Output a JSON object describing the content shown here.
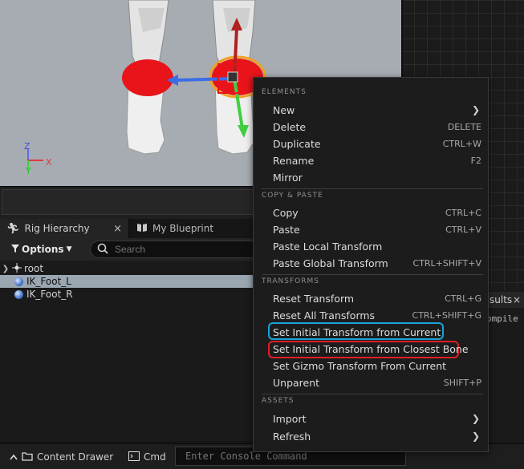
{
  "viewport": {
    "axis": {
      "z": "Z",
      "y": "Y",
      "x": "X"
    },
    "colors": {
      "background": "#a7acb3",
      "axis_x": "#e03a3a",
      "axis_y": "#3fcf3f",
      "axis_z": "#5a6ee6"
    }
  },
  "tabs": [
    {
      "label": "Rig Hierarchy",
      "icon": "running-figure-icon",
      "close": "×"
    },
    {
      "label": "My Blueprint",
      "icon": "book-icon"
    }
  ],
  "hierarchy": {
    "options_label": "Options",
    "search_placeholder": "Search",
    "items": [
      {
        "label": "root"
      },
      {
        "label": "IK_Foot_L"
      },
      {
        "label": "IK_Foot_R"
      }
    ]
  },
  "context_menu": {
    "sections": [
      {
        "title": "ELEMENTS",
        "items": [
          {
            "label": "New",
            "shortcut": "",
            "submenu": true
          },
          {
            "label": "Delete",
            "shortcut": "DELETE"
          },
          {
            "label": "Duplicate",
            "shortcut": "CTRL+W"
          },
          {
            "label": "Rename",
            "shortcut": "F2"
          },
          {
            "label": "Mirror",
            "shortcut": ""
          }
        ]
      },
      {
        "title": "COPY & PASTE",
        "items": [
          {
            "label": "Copy",
            "shortcut": "CTRL+C"
          },
          {
            "label": "Paste",
            "shortcut": "CTRL+V"
          },
          {
            "label": "Paste Local Transform",
            "shortcut": ""
          },
          {
            "label": "Paste Global Transform",
            "shortcut": "CTRL+SHIFT+V"
          }
        ]
      },
      {
        "title": "TRANSFORMS",
        "items": [
          {
            "label": "Reset Transform",
            "shortcut": "CTRL+G"
          },
          {
            "label": "Reset All Transforms",
            "shortcut": "CTRL+SHIFT+G"
          },
          {
            "label": "Set Initial Transform from Current",
            "shortcut": ""
          },
          {
            "label": "Set Initial Transform from Closest Bone",
            "shortcut": ""
          },
          {
            "label": "Set Gizmo Transform From Current",
            "shortcut": ""
          },
          {
            "label": "Unparent",
            "shortcut": "SHIFT+P"
          }
        ]
      },
      {
        "title": "ASSETS",
        "items": [
          {
            "label": "Import",
            "shortcut": "",
            "submenu": true
          },
          {
            "label": "Refresh",
            "shortcut": "",
            "submenu": true
          }
        ]
      }
    ],
    "highlight_colors": {
      "blue": "#1aa3d8",
      "red": "#e01f2a"
    }
  },
  "right_panel": {
    "tab_label": "sults",
    "close": "×",
    "text": "ompile"
  },
  "status_bar": {
    "content_drawer": "Content Drawer",
    "cmd": "Cmd",
    "console_placeholder": "Enter Console Command"
  }
}
